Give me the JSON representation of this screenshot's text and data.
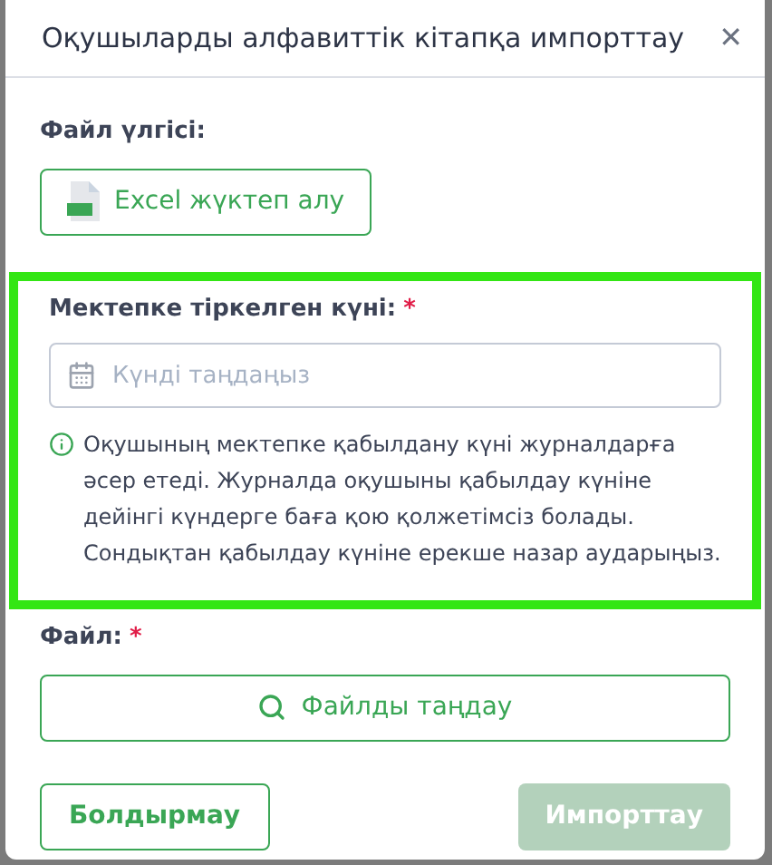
{
  "dialog": {
    "title": "Оқушыларды алфавиттік кітапқа импорттау",
    "close": "✕"
  },
  "template": {
    "label": "Файл үлгісі:",
    "button": "Excel жүктеп алу"
  },
  "date": {
    "label": "Мектепке тіркелген күні:",
    "required": true,
    "required_mark": "*",
    "highlighted": true,
    "placeholder": "Күнді таңдаңыз",
    "hint": "Оқушының мектепке қабылдану күні журналдарға әсер етеді. Журналда оқушыны қабылдау күніне дейінгі күндерге баға қою қолжетімсіз болады. Сондықтан қабылдау күніне ерекше назар аударыңыз."
  },
  "file": {
    "label": "Файл:",
    "required": true,
    "required_mark": "*",
    "button": "Файлды таңдау"
  },
  "buttons": [
    {
      "label": "Болдырмау",
      "kind": "outline",
      "disabled": false
    },
    {
      "label": "Импорттау",
      "kind": "primary",
      "disabled": true
    }
  ]
}
